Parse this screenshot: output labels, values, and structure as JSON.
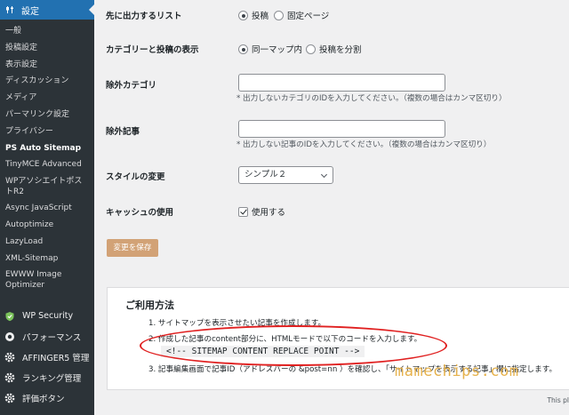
{
  "sidebar": {
    "header": {
      "label": "設定",
      "icon": "settings-icon"
    },
    "submenu": [
      {
        "label": "一般"
      },
      {
        "label": "投稿設定"
      },
      {
        "label": "表示設定"
      },
      {
        "label": "ディスカッション"
      },
      {
        "label": "メディア"
      },
      {
        "label": "パーマリンク設定"
      },
      {
        "label": "プライバシー"
      },
      {
        "label": "PS Auto Sitemap",
        "current": true
      },
      {
        "label": "TinyMCE Advanced"
      },
      {
        "label": "WPアソシエイトポストR2"
      },
      {
        "label": "Async JavaScript"
      },
      {
        "label": "Autoptimize"
      },
      {
        "label": "LazyLoad"
      },
      {
        "label": "XML-Sitemap"
      },
      {
        "label": "EWWW Image Optimizer"
      }
    ],
    "main_items": [
      {
        "label": "WP Security",
        "icon": "shield-icon"
      },
      {
        "label": "パフォーマンス",
        "icon": "performance-icon"
      },
      {
        "label": "AFFINGER5 管理",
        "icon": "gear-icon"
      },
      {
        "label": "ランキング管理",
        "icon": "gear-icon"
      },
      {
        "label": "評価ボタン",
        "icon": "gear-icon"
      }
    ]
  },
  "form": {
    "list_first": {
      "label": "先に出力するリスト",
      "options": [
        "投稿",
        "固定ページ"
      ],
      "selected": "投稿"
    },
    "category_display": {
      "label": "カテゴリーと投稿の表示",
      "options": [
        "同一マップ内",
        "投稿を分割"
      ],
      "selected": "同一マップ内"
    },
    "exclude_category": {
      "label": "除外カテゴリ",
      "value": "",
      "note": "* 出力しないカテゴリのIDを入力してください。（複数の場合はカンマ区切り）"
    },
    "exclude_post": {
      "label": "除外記事",
      "value": "",
      "note": "* 出力しない記事のIDを入力してください。（複数の場合はカンマ区切り）"
    },
    "style": {
      "label": "スタイルの変更",
      "selected": "シンプル２"
    },
    "cache": {
      "label": "キャッシュの使用",
      "checkbox_label": "使用する",
      "checked": true
    },
    "save_label": "変更を保存"
  },
  "usage": {
    "title": "ご利用方法",
    "steps": [
      "1. サイトマップを表示させたい記事を作成します。",
      "2. 作成した記事のcontent部分に、HTMLモードで以下のコードを入力します。",
      "3. 記事編集画面で記事ID（アドレスバーの &post=nn ）を確認し、「サイトマップを表示する記事」欄に指定します。"
    ],
    "code": "<!-- SITEMAP CONTENT REPLACE POINT -->"
  },
  "watermark": "mamechips.com",
  "footer_text": "This pl"
}
